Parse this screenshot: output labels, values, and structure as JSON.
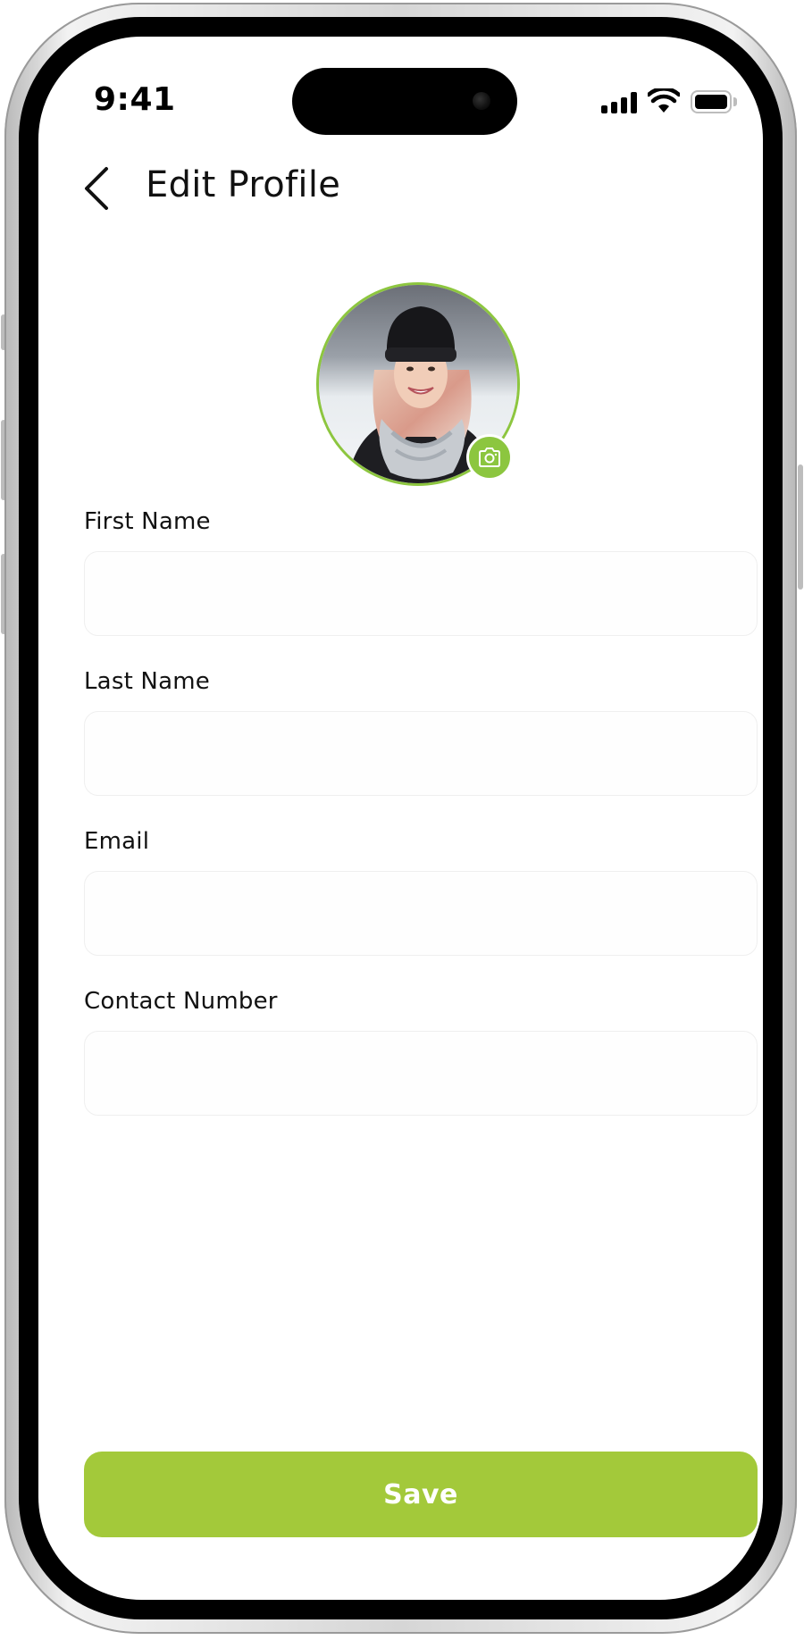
{
  "status_bar": {
    "time": "9:41"
  },
  "header": {
    "title": "Edit Profile",
    "back_icon": "chevron-left-icon"
  },
  "profile": {
    "avatar_icon": "camera-icon",
    "accent_color": "#8cc63f"
  },
  "form": {
    "fields": [
      {
        "label": "First Name",
        "value": "",
        "placeholder": ""
      },
      {
        "label": "Last Name",
        "value": "",
        "placeholder": ""
      },
      {
        "label": "Email",
        "value": "",
        "placeholder": ""
      },
      {
        "label": "Contact Number",
        "value": "",
        "placeholder": ""
      }
    ]
  },
  "actions": {
    "save_label": "Save",
    "save_color": "#a3c93a"
  }
}
